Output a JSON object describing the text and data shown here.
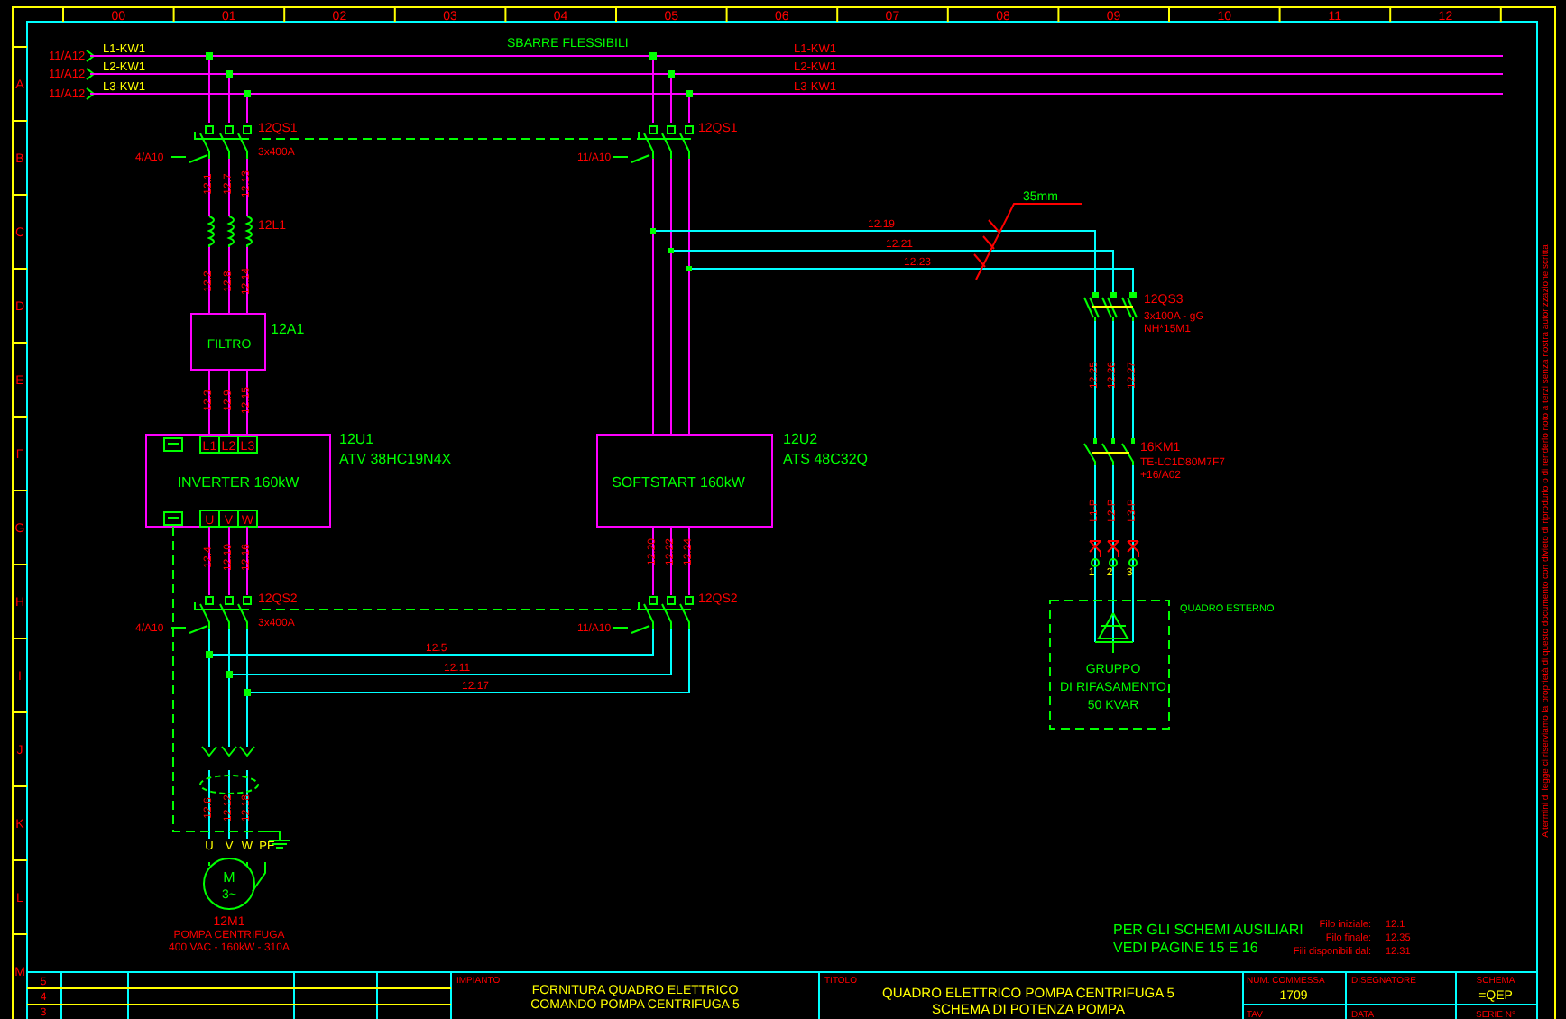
{
  "frame": {
    "columns": [
      "00",
      "01",
      "02",
      "03",
      "04",
      "05",
      "06",
      "07",
      "08",
      "09",
      "10",
      "11",
      "12"
    ],
    "rows": [
      "A",
      "B",
      "C",
      "D",
      "E",
      "F",
      "G",
      "H",
      "I",
      "J",
      "K",
      "L",
      "M"
    ],
    "side_note": "A termini di legge ci riserviamo la proprietà di questo documento con divieto di riprodurlo o di renderlo noto a terzi senza nostra autorizzazione scritta"
  },
  "busbar": {
    "title": "SBARRE FLESSIBILI",
    "feeds": [
      {
        "ref": "11/A12",
        "phase": "L1-KW1"
      },
      {
        "ref": "11/A12",
        "phase": "L2-KW1"
      },
      {
        "ref": "11/A12",
        "phase": "L3-KW1"
      }
    ],
    "phase_labels": [
      "L1-KW1",
      "L2-KW1",
      "L3-KW1"
    ]
  },
  "inverter_branch": {
    "main_switch": {
      "tag": "12QS1",
      "rating": "3x400A",
      "aux": "4/A10"
    },
    "wires_1": [
      "12.1",
      "12.7",
      "12.13"
    ],
    "reactor": "12L1",
    "wires_2": [
      "12.2",
      "12.8",
      "12.14"
    ],
    "filter": {
      "name": "FILTRO",
      "tag": "12A1"
    },
    "wires_3": [
      "12.3",
      "12.9",
      "12.15"
    ],
    "drive": {
      "name": "INVERTER 160kW",
      "tag": "12U1",
      "model": "ATV 38HC19N4X",
      "inputs": [
        "L1",
        "L2",
        "L3"
      ],
      "outputs": [
        "U",
        "V",
        "W"
      ]
    },
    "wires_4": [
      "12.4",
      "12.10",
      "12.16"
    ],
    "output_switch": {
      "tag": "12QS2",
      "rating": "3x400A",
      "aux": "4/A10"
    },
    "bypass_wires": [
      "12.5",
      "12.11",
      "12.17"
    ],
    "wires_5": [
      "12.6",
      "12.12",
      "12.18"
    ],
    "motor": {
      "terminals": [
        "U",
        "V",
        "W",
        "PE"
      ],
      "symbol": "M",
      "phases": "3~",
      "tag": "12M1",
      "name": "POMPA CENTRIFUGA",
      "rating": "400 VAC - 160kW - 310A"
    }
  },
  "softstart_branch": {
    "main_switch": {
      "tag": "12QS1",
      "aux": "11/A10"
    },
    "drive": {
      "name": "SOFTSTART 160kW",
      "tag": "12U2",
      "model": "ATS 48C32Q"
    },
    "wires_out": [
      "12.20",
      "12.22",
      "12.24"
    ],
    "output_switch": {
      "tag": "12QS2",
      "aux": "11/A10"
    }
  },
  "capacitor_branch": {
    "feed_wires": [
      "12.19",
      "12.21",
      "12.23"
    ],
    "cable": "35mm",
    "fuse_switch": {
      "tag": "12QS3",
      "rating": "3x100A - gG",
      "model": "NH*15M1"
    },
    "wires_1": [
      "12.25",
      "12.26",
      "12.27"
    ],
    "contactor": {
      "tag": "16KM1",
      "model": "TE-LC1D80M7F7",
      "ref": "+16/A02"
    },
    "wires_2": [
      "L1-P",
      "L2-P",
      "L3-P"
    ],
    "terminals": [
      "1",
      "2",
      "3"
    ],
    "enclosure": "QUADRO ESTERNO",
    "bank": [
      "GRUPPO",
      "DI RIFASAMENTO",
      "50 KVAR"
    ]
  },
  "notes": {
    "aux_ref": [
      "PER GLI SCHEMI AUSILIARI",
      "VEDI PAGINE 15 E 16"
    ],
    "wire_info": [
      {
        "label": "Filo iniziale:",
        "value": "12.1"
      },
      {
        "label": "Filo finale:",
        "value": "12.35"
      },
      {
        "label": "Fili disponibili dal:",
        "value": "12.31"
      }
    ]
  },
  "title_block": {
    "revisions": [
      "5",
      "4",
      "3"
    ],
    "plant_label": "IMPIANTO",
    "plant": [
      "FORNITURA QUADRO ELETTRICO",
      "COMANDO POMPA CENTRIFUGA 5"
    ],
    "title_label": "TITOLO",
    "title": [
      "QUADRO ELETTRICO POMPA CENTRIFUGA 5",
      "SCHEMA DI POTENZA POMPA"
    ],
    "fields": [
      {
        "label": "NUM. COMMESSA",
        "value": "1709"
      },
      {
        "label": "DISEGNATORE"
      },
      {
        "label": "SCHEMA",
        "value": "=QEP"
      },
      {
        "label": "TAV"
      },
      {
        "label": "DATA"
      },
      {
        "label": "SERIE N°"
      }
    ]
  }
}
